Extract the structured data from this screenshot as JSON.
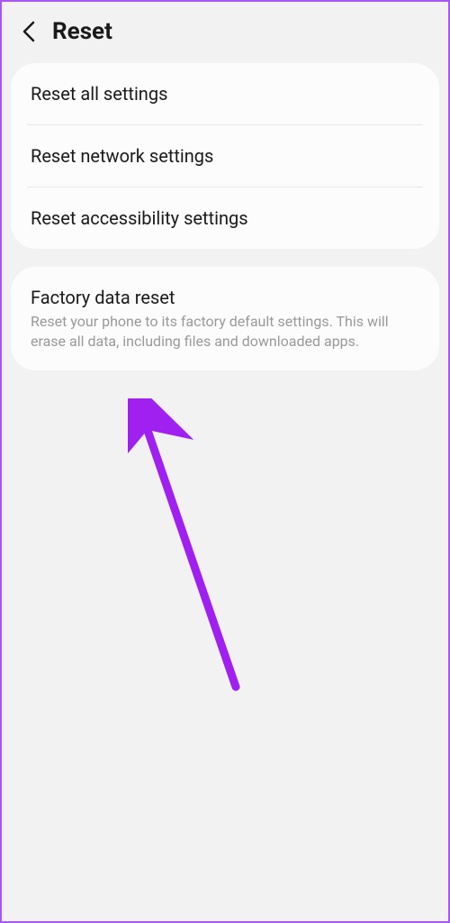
{
  "header": {
    "title": "Reset"
  },
  "group1": {
    "items": [
      {
        "title": "Reset all settings"
      },
      {
        "title": "Reset network settings"
      },
      {
        "title": "Reset accessibility settings"
      }
    ]
  },
  "group2": {
    "items": [
      {
        "title": "Factory data reset",
        "desc": "Reset your phone to its factory default settings. This will erase all data, including files and downloaded apps."
      }
    ]
  },
  "annotation": {
    "arrow_color": "#a020f0"
  }
}
